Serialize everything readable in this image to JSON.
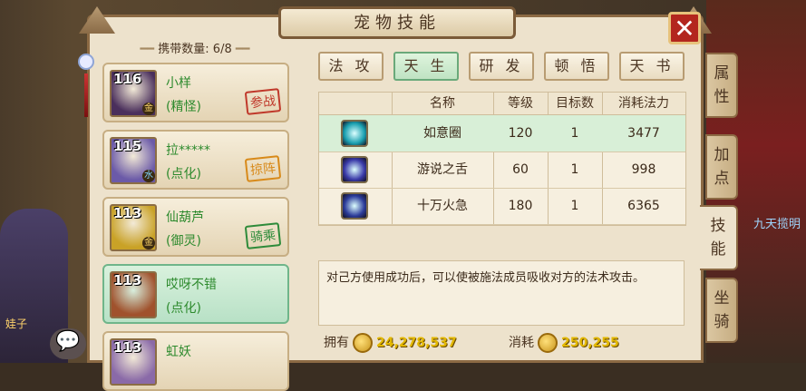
{
  "window": {
    "title": "宠物技能",
    "close_label": "✕"
  },
  "carry": {
    "label": "携带数量:",
    "count": "6/8"
  },
  "pets": [
    {
      "level": "116",
      "name": "小样",
      "type": "(精怪)",
      "element": "金",
      "badge": "参战",
      "badge_kind": "fight",
      "portrait_color": "#4a2f5c",
      "active": false
    },
    {
      "level": "115",
      "name": "拉*****",
      "type": "(点化)",
      "element": "水",
      "badge": "掠阵",
      "badge_kind": "guard",
      "portrait_color": "#6b5aa8",
      "active": false
    },
    {
      "level": "113",
      "name": "仙葫芦",
      "type": "(御灵)",
      "element": "金",
      "badge": "骑乘",
      "badge_kind": "ride",
      "portrait_color": "#c9a227",
      "active": false
    },
    {
      "level": "113",
      "name": "哎呀不错",
      "type": "(点化)",
      "element": "",
      "badge": "",
      "badge_kind": "",
      "portrait_color": "#a0522d",
      "active": true
    },
    {
      "level": "113",
      "name": "虹妖",
      "type": "",
      "element": "",
      "badge": "",
      "badge_kind": "",
      "portrait_color": "#8a6aa8",
      "active": false
    }
  ],
  "tabs": [
    "法 攻",
    "天 生",
    "研 发",
    "顿 悟",
    "天 书"
  ],
  "active_tab": 1,
  "table": {
    "headers": {
      "name": "名称",
      "level": "等级",
      "targets": "目标数",
      "cost": "消耗法力"
    },
    "rows": [
      {
        "name": "如意圈",
        "level": "120",
        "targets": "1",
        "cost": "3477",
        "icon_color": "#1aa0b0",
        "selected": true
      },
      {
        "name": "游说之舌",
        "level": "60",
        "targets": "1",
        "cost": "998",
        "icon_color": "#3a3aa8",
        "selected": false
      },
      {
        "name": "十万火急",
        "level": "180",
        "targets": "1",
        "cost": "6365",
        "icon_color": "#2c3c9a",
        "selected": false
      }
    ]
  },
  "description": "对己方使用成功后，可以使被施法成员吸收对方的法术攻击。",
  "currency": {
    "own_label": "拥有",
    "own_amount": "24,278,537",
    "cost_label": "消耗",
    "cost_amount": "250,255"
  },
  "side_tabs": [
    "属性",
    "加点",
    "技能",
    "坐骑"
  ],
  "active_side_tab": 2,
  "background": {
    "right_label": "九天揽明",
    "left_label": "娃子",
    "chat_icon": "💬"
  }
}
